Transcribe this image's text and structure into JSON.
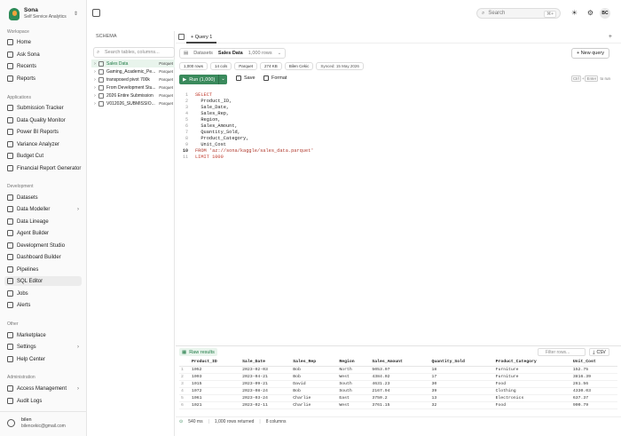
{
  "brand": {
    "name": "Sona",
    "subtitle": "Self Service Analytics"
  },
  "sidebar": {
    "sections": [
      {
        "label": "Workspace",
        "items": [
          "Home",
          "Ask Sona",
          "Recents",
          "Reports"
        ]
      },
      {
        "label": "Applications",
        "items": [
          "Submission Tracker",
          "Data Quality Monitor",
          "Power BI Reports",
          "Variance Analyzer",
          "Budget Cut",
          "Financial Report Generator"
        ]
      },
      {
        "label": "Development",
        "items": [
          "Datasets",
          "Data Modeller",
          "Data Lineage",
          "Agent Builder",
          "Development Studio",
          "Dashboard Builder",
          "Pipelines",
          "SQL Editor",
          "Jobs",
          "Alerts"
        ]
      },
      {
        "label": "Other",
        "items": [
          "Marketplace",
          "Settings",
          "Help Center"
        ]
      },
      {
        "label": "Administration",
        "items": [
          "Access Management",
          "Audit Logs"
        ]
      }
    ]
  },
  "user": {
    "name": "bilen",
    "email": "bilencekic@gmail.com"
  },
  "topbar": {
    "search_placeholder": "Search",
    "shortcut": "⌘+",
    "avatar": "BC"
  },
  "schema": {
    "title": "SCHEMA",
    "search_placeholder": "Search tables, columns...",
    "tables": [
      {
        "name": "Sales Data",
        "badge": "Parquet"
      },
      {
        "name": "Gaming_Academic_Pe...",
        "badge": "Parquet"
      },
      {
        "name": "transposed pivot 700k",
        "badge": "Parquet"
      },
      {
        "name": "From Development Stu...",
        "badge": "Parquet"
      },
      {
        "name": "2026 Entire Submission",
        "badge": "Parquet"
      },
      {
        "name": "V012026_SUBMISSIO...",
        "badge": "Parquet"
      }
    ]
  },
  "tabs": {
    "query": "Query 1",
    "plus": "+"
  },
  "dataset": {
    "label": "Datasets",
    "name": "Sales Data",
    "rows": "1,000 rows",
    "new_query": "+ New query"
  },
  "pills": [
    "1,000 rows",
    "14 cols",
    "Parquet",
    "274 KB",
    "Bilen Cekic",
    "Synced: 15 May 2026"
  ],
  "toolbar": {
    "run": "Run (1,000)",
    "save": "Save",
    "format": "Format",
    "hint_ctrl": "Ctrl",
    "hint_enter": "Enter",
    "hint_text": "to run"
  },
  "sql": {
    "line_numbers": [
      "1",
      "2",
      "3",
      "4",
      "5",
      "6",
      "7",
      "8",
      "9",
      "10",
      "11"
    ],
    "lines": [
      "SELECT",
      "  Product_ID,",
      "  Sale_Date,",
      "  Sales_Rep,",
      "  Region,",
      "  Sales_Amount,",
      "  Quantity_Sold,",
      "  Product_Category,",
      "  Unit_Cost",
      "FROM 'az://sona/kaggle/sales_data.parquet'",
      "LIMIT 1000"
    ]
  },
  "results": {
    "tab": "Raw results",
    "filter_placeholder": "Filter rows...",
    "csv": "CSV",
    "columns": [
      "Product_ID",
      "Sale_Date",
      "Sales_Rep",
      "Region",
      "Sales_Amount",
      "Quantity_Sold",
      "Product_Category",
      "Unit_Cost"
    ],
    "rows": [
      [
        "1",
        "1052",
        "2023-02-03",
        "Bob",
        "North",
        "5053.97",
        "18",
        "Furniture",
        "152.75"
      ],
      [
        "2",
        "1093",
        "2023-04-21",
        "Bob",
        "West",
        "4384.02",
        "17",
        "Furniture",
        "3816.39"
      ],
      [
        "3",
        "1015",
        "2023-09-21",
        "David",
        "South",
        "4631.23",
        "30",
        "Food",
        "261.56"
      ],
      [
        "4",
        "1072",
        "2023-08-24",
        "Bob",
        "South",
        "2167.94",
        "39",
        "Clothing",
        "4330.03"
      ],
      [
        "5",
        "1061",
        "2023-03-24",
        "Charlie",
        "East",
        "3750.2",
        "13",
        "Electronics",
        "637.37"
      ],
      [
        "6",
        "1021",
        "2023-02-11",
        "Charlie",
        "West",
        "3761.15",
        "32",
        "Food",
        "900.79"
      ]
    ],
    "status": {
      "time": "540 ms",
      "returned": "1,000 rows returned",
      "cols": "8 columns"
    }
  }
}
